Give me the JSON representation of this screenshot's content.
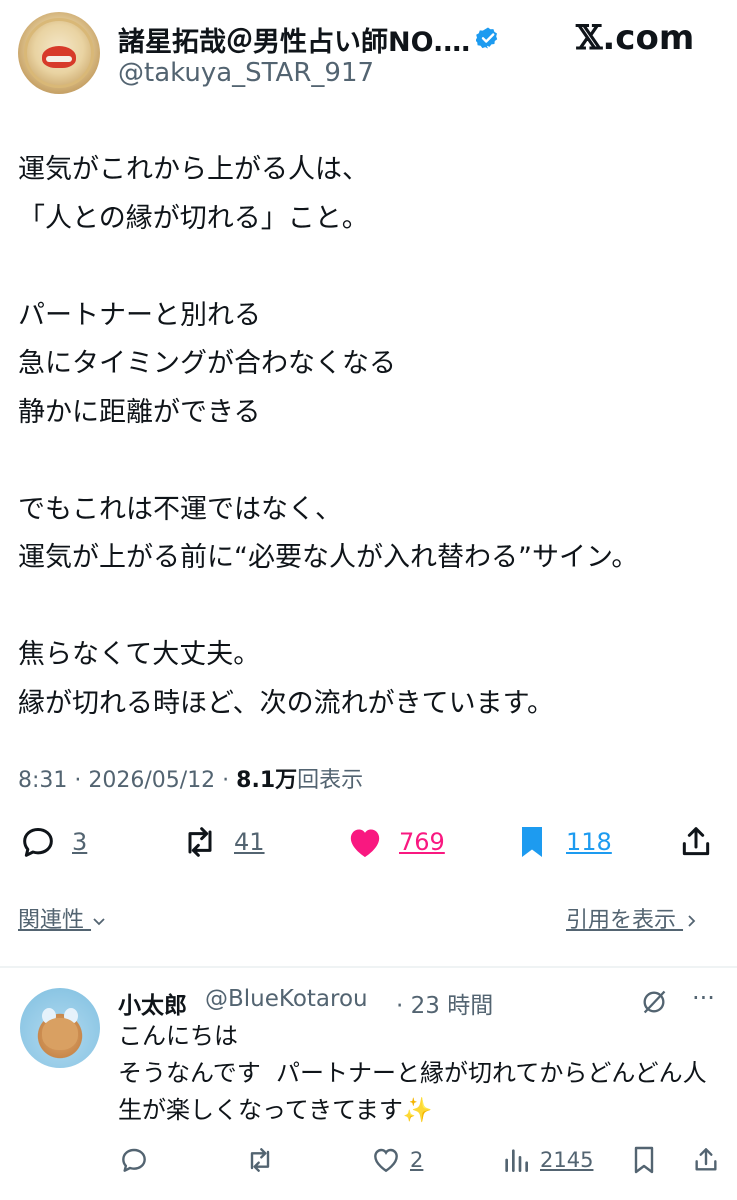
{
  "header": {
    "author_name": "諸星拓哉＠男性占い師NO.…",
    "handle": "@takuya_STAR_917",
    "site": ".com",
    "site_logo": "𝕏"
  },
  "post": {
    "text": "運気がこれから上がる人は、\n「人との縁が切れる」こと。\n\nパートナーと別れる\n急にタイミングが合わなくなる\n静かに距離ができる\n\nでもこれは不運ではなく、\n運気が上がる前に“必要な人が入れ替わる”サイン。\n\n焦らなくて大丈夫。\n縁が切れる時ほど、次の流れがきています。",
    "time": "8:31 · 2026/05/12 · ",
    "views": "8.1万",
    "views_suffix": "回表示"
  },
  "actions": {
    "replies": "3",
    "retweets": "41",
    "likes": "769",
    "bookmarks": "118"
  },
  "links": {
    "related": "関連性",
    "quotes": "引用を表示"
  },
  "reply": {
    "name": "小太郎",
    "handle": "@BlueKotarou",
    "time": "· 23 時間",
    "more": "···",
    "text": "こんにちは\nそうなんです  パートナーと縁が切れてからどんどん人生が楽しくなってきてます✨",
    "likes": "2",
    "views": "2145"
  },
  "colors": {
    "like": "#f91880",
    "bookmark": "#1d9bf0",
    "verified": "#1d9bf0",
    "muted": "#536471"
  },
  "icons": [
    "verified-icon",
    "reply-icon",
    "retweet-icon",
    "heart-icon",
    "bookmark-icon",
    "share-icon",
    "chevron-down-icon",
    "chevron-right-icon",
    "grok-icon",
    "more-icon",
    "views-icon"
  ]
}
